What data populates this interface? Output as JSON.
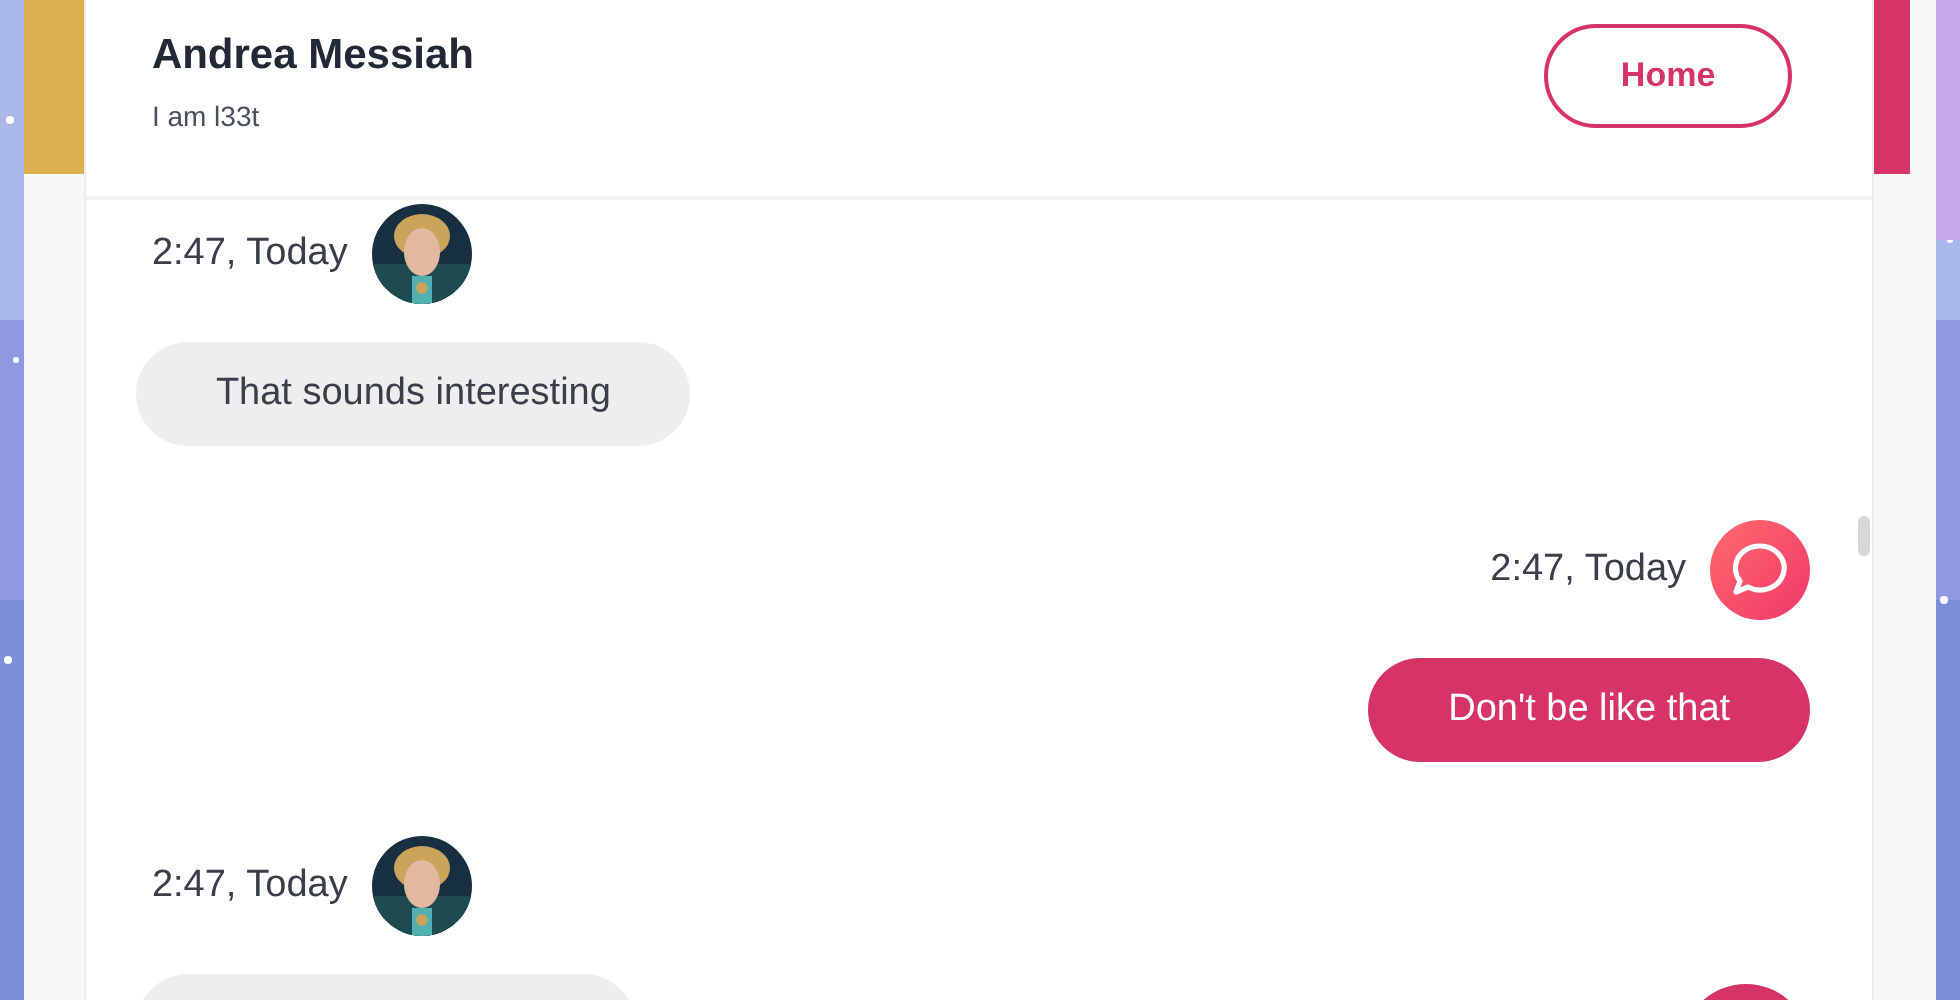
{
  "header": {
    "name": "Andrea Messiah",
    "status": "I am l33t",
    "home_button": "Home"
  },
  "messages": [
    {
      "kind": "incoming",
      "time": "2:47, Today",
      "text": "That sounds interesting"
    },
    {
      "kind": "outgoing",
      "time": "2:47, Today",
      "text": "Don't be like that"
    },
    {
      "kind": "partial",
      "time": "2:47, Today"
    }
  ]
}
